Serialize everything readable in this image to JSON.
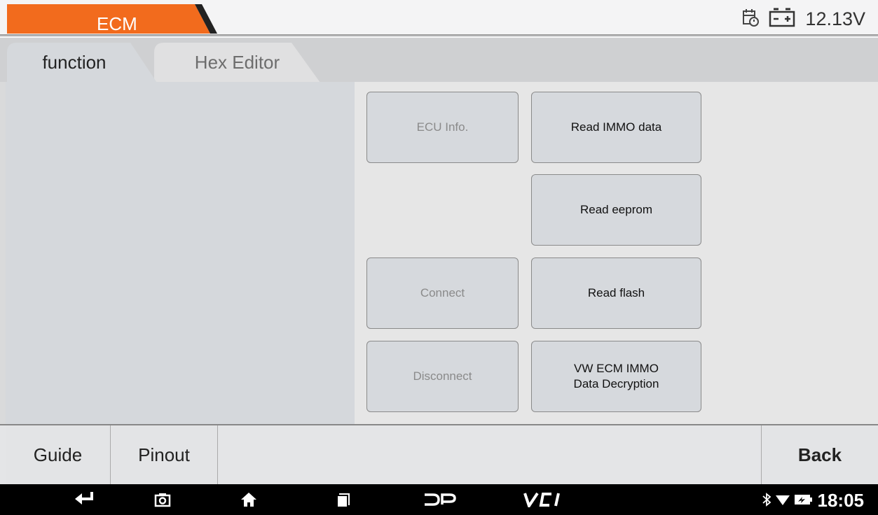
{
  "header": {
    "title": "ECM",
    "voltage": "12.13V",
    "accent_color": "#f26b1d"
  },
  "tabs": [
    {
      "label": "function",
      "active": true
    },
    {
      "label": "Hex Editor",
      "active": false
    }
  ],
  "buttons": {
    "ecu_info": {
      "label": "ECU Info.",
      "enabled": false
    },
    "read_immo": {
      "label": "Read IMMO data",
      "enabled": true
    },
    "read_eeprom": {
      "label": "Read eeprom",
      "enabled": true
    },
    "connect": {
      "label": "Connect",
      "enabled": false
    },
    "read_flash": {
      "label": "Read flash",
      "enabled": true
    },
    "disconnect": {
      "label": "Disconnect",
      "enabled": false
    },
    "vw_decrypt": {
      "label": "VW ECM IMMO Data Decryption",
      "enabled": true
    }
  },
  "bottom": {
    "guide": "Guide",
    "pinout": "Pinout",
    "back": "Back"
  },
  "system": {
    "time": "18:05",
    "icons": [
      "back-arrow-icon",
      "camera-icon",
      "home-icon",
      "recents-icon",
      "dp-icon",
      "vci-icon",
      "bluetooth-icon",
      "wifi-icon",
      "battery-icon"
    ]
  }
}
